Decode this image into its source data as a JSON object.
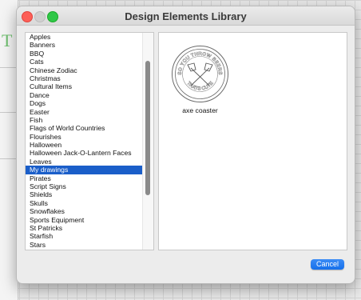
{
  "window": {
    "title": "Design Elements Library"
  },
  "categories": [
    {
      "label": "Apples"
    },
    {
      "label": "Banners"
    },
    {
      "label": "BBQ"
    },
    {
      "label": "Cats"
    },
    {
      "label": "Chinese Zodiac"
    },
    {
      "label": "Christmas"
    },
    {
      "label": "Cultural Items"
    },
    {
      "label": "Dance"
    },
    {
      "label": "Dogs"
    },
    {
      "label": "Easter"
    },
    {
      "label": "Fish"
    },
    {
      "label": "Flags of World Countries"
    },
    {
      "label": "Flourishes"
    },
    {
      "label": "Halloween"
    },
    {
      "label": "Halloween Jack-O-Lantern Faces"
    },
    {
      "label": "Leaves"
    },
    {
      "label": "My drawings",
      "selected": true
    },
    {
      "label": "Pirates"
    },
    {
      "label": "Script Signs"
    },
    {
      "label": "Shields"
    },
    {
      "label": "Skulls"
    },
    {
      "label": "Snowflakes"
    },
    {
      "label": "Sports Equipment"
    },
    {
      "label": "St Patricks"
    },
    {
      "label": "Starfish"
    },
    {
      "label": "Stars"
    }
  ],
  "preview": {
    "item_label": "axe coaster",
    "coaster_top_text": "SO YOU THROW BEERS",
    "coaster_bottom_text": "THATS CUTE"
  },
  "buttons": {
    "cancel_label": "Cancel"
  },
  "colors": {
    "selection": "#1a5ec9",
    "primary_button": "#1670eb",
    "background_glyph": "#6fbf6f"
  },
  "background": {
    "glyph": "T"
  }
}
